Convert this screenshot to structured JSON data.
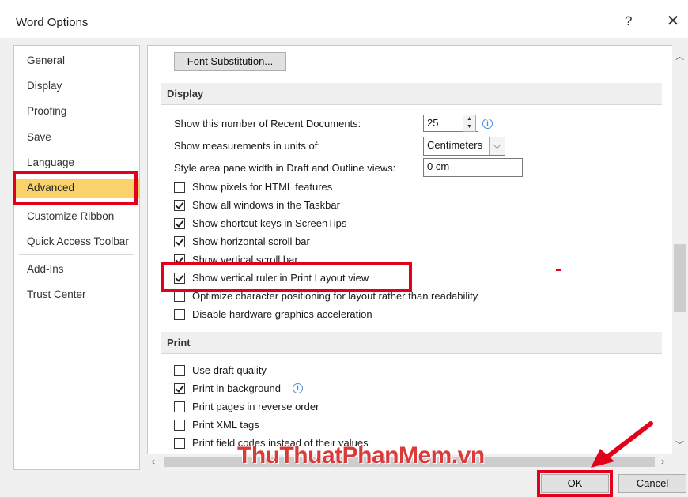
{
  "window": {
    "title": "Word Options",
    "help": "?",
    "close": "✕"
  },
  "nav": {
    "items": [
      {
        "label": "General"
      },
      {
        "label": "Display"
      },
      {
        "label": "Proofing"
      },
      {
        "label": "Save"
      },
      {
        "label": "Language"
      },
      {
        "label": "Advanced",
        "selected": true
      },
      {
        "label": "Customize Ribbon"
      },
      {
        "label": "Quick Access Toolbar"
      },
      {
        "label": "Add-Ins"
      },
      {
        "label": "Trust Center"
      }
    ]
  },
  "content": {
    "font_substitution_button": "Font Substitution...",
    "display": {
      "header": "Display",
      "recent_docs_label": "Show this number of Recent Documents:",
      "recent_docs_value": "25",
      "units_label": "Show measurements in units of:",
      "units_value": "Centimeters",
      "style_area_label": "Style area pane width in Draft and Outline views:",
      "style_area_value": "0 cm",
      "checkboxes": [
        {
          "label": "Show pixels for HTML features",
          "checked": false
        },
        {
          "label": "Show all windows in the Taskbar",
          "checked": true
        },
        {
          "label": "Show shortcut keys in ScreenTips",
          "checked": true
        },
        {
          "label": "Show horizontal scroll bar",
          "checked": true
        },
        {
          "label": "Show vertical scroll bar",
          "checked": true
        },
        {
          "label": "Show vertical ruler in Print Layout view",
          "checked": true
        },
        {
          "label": "Optimize character positioning for layout rather than readability",
          "checked": false
        },
        {
          "label": "Disable hardware graphics acceleration",
          "checked": false
        }
      ]
    },
    "print": {
      "header": "Print",
      "checkboxes": [
        {
          "label": "Use draft quality",
          "checked": false
        },
        {
          "label": "Print in background",
          "checked": true
        },
        {
          "label": "Print pages in reverse order",
          "checked": false
        },
        {
          "label": "Print XML tags",
          "checked": false
        },
        {
          "label": "Print field codes instead of their values",
          "checked": false
        }
      ]
    }
  },
  "footer": {
    "ok": "OK",
    "cancel": "Cancel"
  },
  "watermark": "ThuThuatPhanMem.vn",
  "colors": {
    "highlight_red": "#e3001b",
    "selected_nav": "#f9d26b",
    "section_bg": "#efefef"
  }
}
